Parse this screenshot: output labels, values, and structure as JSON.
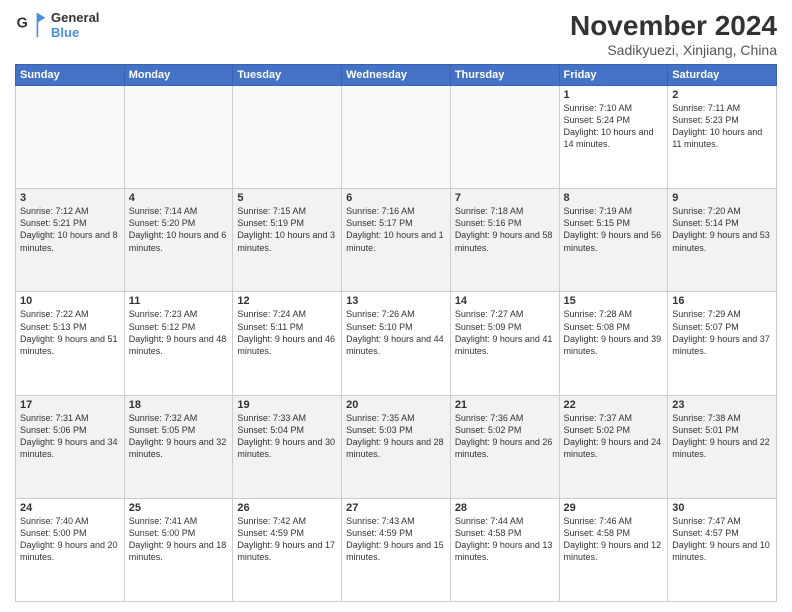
{
  "logo": {
    "line1": "General",
    "line2": "Blue"
  },
  "title": "November 2024",
  "subtitle": "Sadikyuezi, Xinjiang, China",
  "days_of_week": [
    "Sunday",
    "Monday",
    "Tuesday",
    "Wednesday",
    "Thursday",
    "Friday",
    "Saturday"
  ],
  "weeks": [
    [
      {
        "day": "",
        "info": ""
      },
      {
        "day": "",
        "info": ""
      },
      {
        "day": "",
        "info": ""
      },
      {
        "day": "",
        "info": ""
      },
      {
        "day": "",
        "info": ""
      },
      {
        "day": "1",
        "info": "Sunrise: 7:10 AM\nSunset: 5:24 PM\nDaylight: 10 hours and 14 minutes."
      },
      {
        "day": "2",
        "info": "Sunrise: 7:11 AM\nSunset: 5:23 PM\nDaylight: 10 hours and 11 minutes."
      }
    ],
    [
      {
        "day": "3",
        "info": "Sunrise: 7:12 AM\nSunset: 5:21 PM\nDaylight: 10 hours and 8 minutes."
      },
      {
        "day": "4",
        "info": "Sunrise: 7:14 AM\nSunset: 5:20 PM\nDaylight: 10 hours and 6 minutes."
      },
      {
        "day": "5",
        "info": "Sunrise: 7:15 AM\nSunset: 5:19 PM\nDaylight: 10 hours and 3 minutes."
      },
      {
        "day": "6",
        "info": "Sunrise: 7:16 AM\nSunset: 5:17 PM\nDaylight: 10 hours and 1 minute."
      },
      {
        "day": "7",
        "info": "Sunrise: 7:18 AM\nSunset: 5:16 PM\nDaylight: 9 hours and 58 minutes."
      },
      {
        "day": "8",
        "info": "Sunrise: 7:19 AM\nSunset: 5:15 PM\nDaylight: 9 hours and 56 minutes."
      },
      {
        "day": "9",
        "info": "Sunrise: 7:20 AM\nSunset: 5:14 PM\nDaylight: 9 hours and 53 minutes."
      }
    ],
    [
      {
        "day": "10",
        "info": "Sunrise: 7:22 AM\nSunset: 5:13 PM\nDaylight: 9 hours and 51 minutes."
      },
      {
        "day": "11",
        "info": "Sunrise: 7:23 AM\nSunset: 5:12 PM\nDaylight: 9 hours and 48 minutes."
      },
      {
        "day": "12",
        "info": "Sunrise: 7:24 AM\nSunset: 5:11 PM\nDaylight: 9 hours and 46 minutes."
      },
      {
        "day": "13",
        "info": "Sunrise: 7:26 AM\nSunset: 5:10 PM\nDaylight: 9 hours and 44 minutes."
      },
      {
        "day": "14",
        "info": "Sunrise: 7:27 AM\nSunset: 5:09 PM\nDaylight: 9 hours and 41 minutes."
      },
      {
        "day": "15",
        "info": "Sunrise: 7:28 AM\nSunset: 5:08 PM\nDaylight: 9 hours and 39 minutes."
      },
      {
        "day": "16",
        "info": "Sunrise: 7:29 AM\nSunset: 5:07 PM\nDaylight: 9 hours and 37 minutes."
      }
    ],
    [
      {
        "day": "17",
        "info": "Sunrise: 7:31 AM\nSunset: 5:06 PM\nDaylight: 9 hours and 34 minutes."
      },
      {
        "day": "18",
        "info": "Sunrise: 7:32 AM\nSunset: 5:05 PM\nDaylight: 9 hours and 32 minutes."
      },
      {
        "day": "19",
        "info": "Sunrise: 7:33 AM\nSunset: 5:04 PM\nDaylight: 9 hours and 30 minutes."
      },
      {
        "day": "20",
        "info": "Sunrise: 7:35 AM\nSunset: 5:03 PM\nDaylight: 9 hours and 28 minutes."
      },
      {
        "day": "21",
        "info": "Sunrise: 7:36 AM\nSunset: 5:02 PM\nDaylight: 9 hours and 26 minutes."
      },
      {
        "day": "22",
        "info": "Sunrise: 7:37 AM\nSunset: 5:02 PM\nDaylight: 9 hours and 24 minutes."
      },
      {
        "day": "23",
        "info": "Sunrise: 7:38 AM\nSunset: 5:01 PM\nDaylight: 9 hours and 22 minutes."
      }
    ],
    [
      {
        "day": "24",
        "info": "Sunrise: 7:40 AM\nSunset: 5:00 PM\nDaylight: 9 hours and 20 minutes."
      },
      {
        "day": "25",
        "info": "Sunrise: 7:41 AM\nSunset: 5:00 PM\nDaylight: 9 hours and 18 minutes."
      },
      {
        "day": "26",
        "info": "Sunrise: 7:42 AM\nSunset: 4:59 PM\nDaylight: 9 hours and 17 minutes."
      },
      {
        "day": "27",
        "info": "Sunrise: 7:43 AM\nSunset: 4:59 PM\nDaylight: 9 hours and 15 minutes."
      },
      {
        "day": "28",
        "info": "Sunrise: 7:44 AM\nSunset: 4:58 PM\nDaylight: 9 hours and 13 minutes."
      },
      {
        "day": "29",
        "info": "Sunrise: 7:46 AM\nSunset: 4:58 PM\nDaylight: 9 hours and 12 minutes."
      },
      {
        "day": "30",
        "info": "Sunrise: 7:47 AM\nSunset: 4:57 PM\nDaylight: 9 hours and 10 minutes."
      }
    ]
  ]
}
